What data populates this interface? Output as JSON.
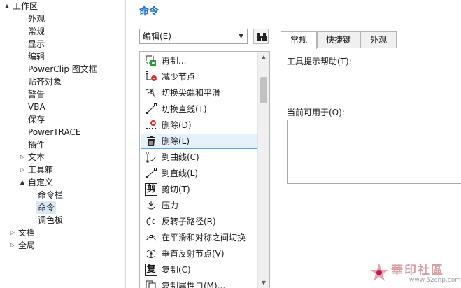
{
  "tree": {
    "items": [
      {
        "label": "工作区",
        "expander": "▲"
      },
      {
        "label": "外观",
        "expander": ""
      },
      {
        "label": "常规",
        "expander": ""
      },
      {
        "label": "显示",
        "expander": ""
      },
      {
        "label": "编辑",
        "expander": ""
      },
      {
        "label": "PowerClip 图文框",
        "expander": ""
      },
      {
        "label": "贴齐对象",
        "expander": ""
      },
      {
        "label": "警告",
        "expander": ""
      },
      {
        "label": "VBA",
        "expander": ""
      },
      {
        "label": "保存",
        "expander": ""
      },
      {
        "label": "PowerTRACE",
        "expander": ""
      },
      {
        "label": "插件",
        "expander": ""
      },
      {
        "label": "文本",
        "expander": "▷"
      },
      {
        "label": "工具箱",
        "expander": "▷"
      },
      {
        "label": "自定义",
        "expander": "▲"
      },
      {
        "label": "命令栏",
        "expander": ""
      },
      {
        "label": "命令",
        "expander": ""
      },
      {
        "label": "调色板",
        "expander": ""
      },
      {
        "label": "文档",
        "expander": "▷"
      },
      {
        "label": "全局",
        "expander": "▷"
      }
    ]
  },
  "main": {
    "title": "命令",
    "category": "编辑(E)",
    "commands": [
      {
        "label": "再制...",
        "icon": "duplicate-icon"
      },
      {
        "label": "减少节点",
        "icon": "reduce-nodes-icon"
      },
      {
        "label": "切换尖端和平滑",
        "icon": "toggle-cusp-smooth-icon"
      },
      {
        "label": "切换直线(T)",
        "icon": "toggle-line-icon"
      },
      {
        "label": "删除(D)",
        "icon": "delete-node-icon"
      },
      {
        "label": "删除(L)",
        "icon": "trash-icon"
      },
      {
        "label": "到曲线(C)",
        "icon": "to-curve-icon"
      },
      {
        "label": "到直线(L)",
        "icon": "to-line-icon"
      },
      {
        "label": "剪切(T)",
        "icon": "cut-glyph-icon",
        "glyph": "剪"
      },
      {
        "label": "压力",
        "icon": "pressure-icon"
      },
      {
        "label": "反转子路径(R)",
        "icon": "reverse-subpath-icon"
      },
      {
        "label": "在平滑和对称之间切换",
        "icon": "smooth-symmetric-icon"
      },
      {
        "label": "垂直反射节点(V)",
        "icon": "reflect-vertical-icon"
      },
      {
        "label": "复制(C)",
        "icon": "copy-glyph-icon",
        "glyph": "复"
      },
      {
        "label": "复制属性自(M)...",
        "icon": "copy-attributes-icon"
      }
    ],
    "tabs": [
      "常规",
      "快捷键",
      "外观"
    ],
    "tooltip_label": "工具提示帮助(T):",
    "available_label": "当前可用于(O):"
  },
  "watermark": {
    "text": "華印社區",
    "url": "www.52cnp.com"
  },
  "colors": {
    "accent": "#1e70c2",
    "selection": "#e5f1fb"
  }
}
